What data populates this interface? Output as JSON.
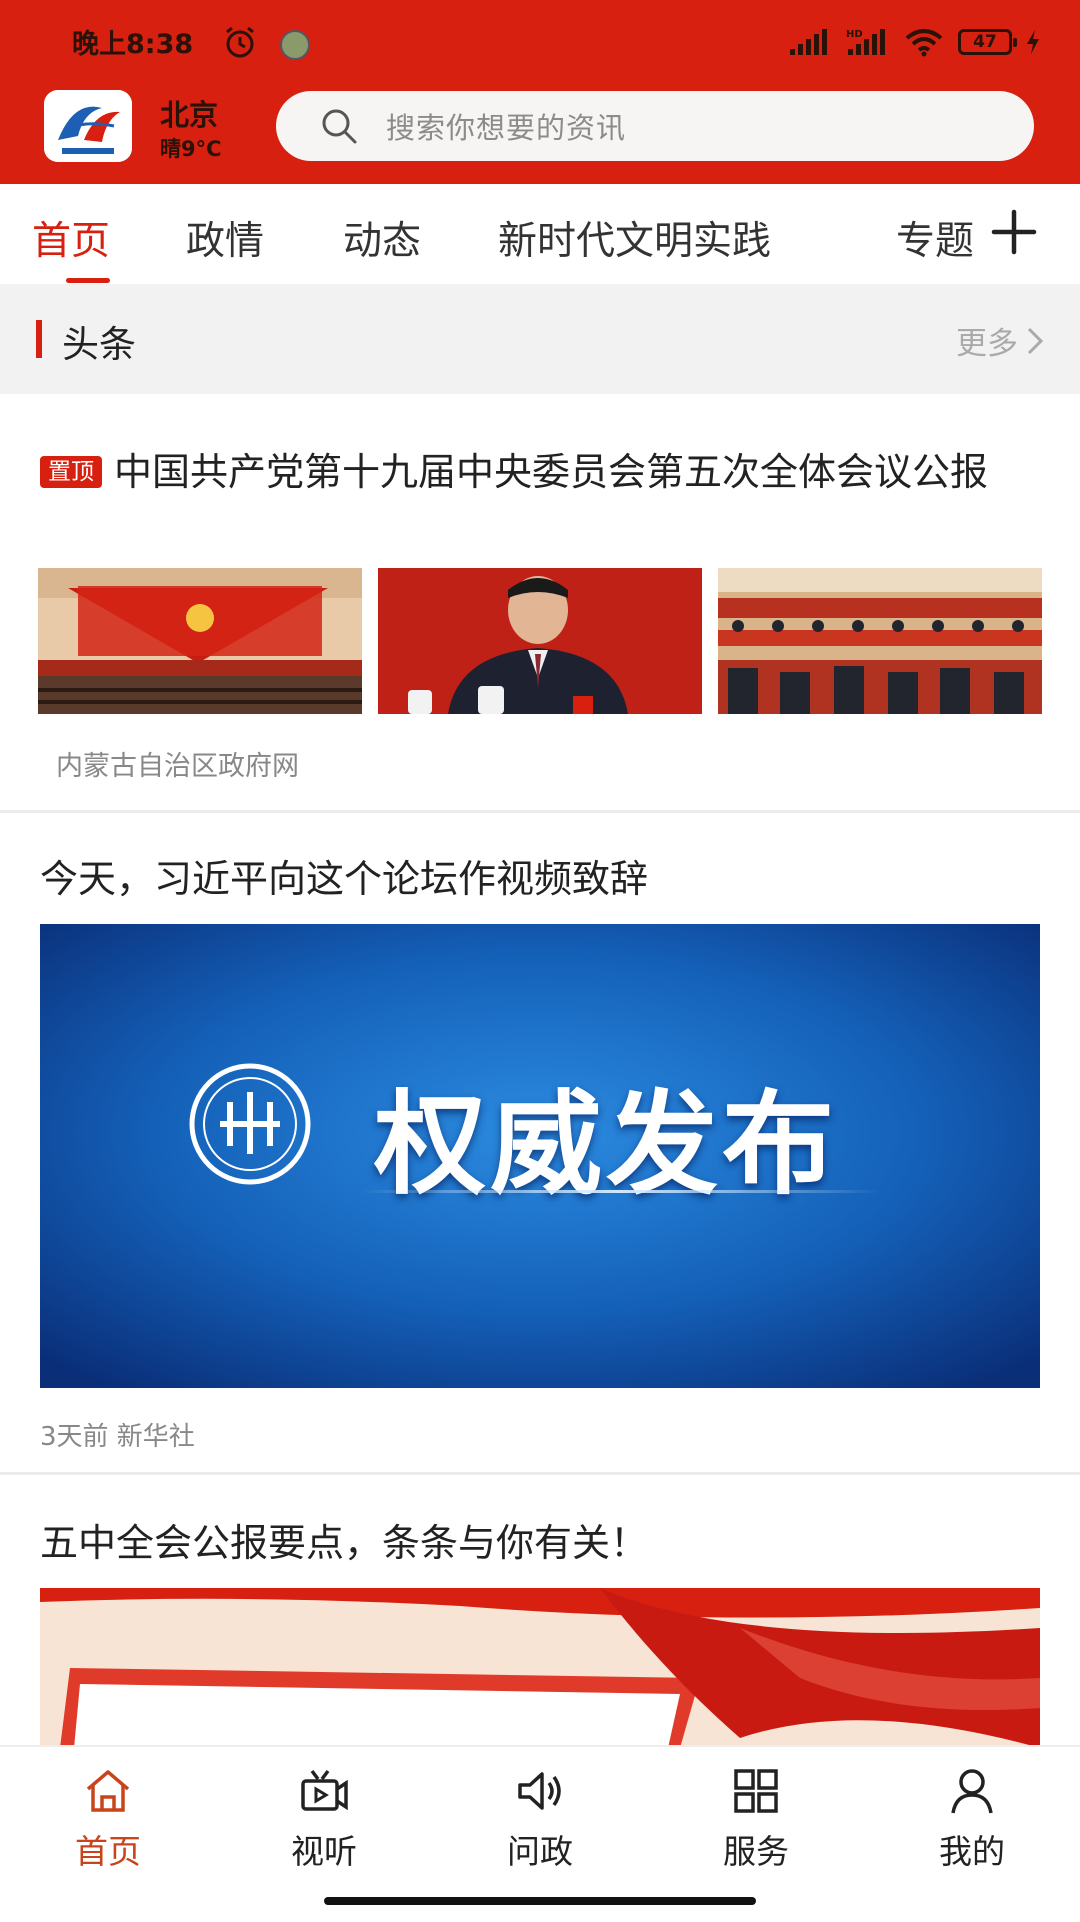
{
  "status_bar": {
    "time": "晚上8:38",
    "battery": "47"
  },
  "header": {
    "city": "北京",
    "weather": "晴9°C",
    "search_placeholder": "搜索你想要的资讯"
  },
  "tabs": [
    {
      "label": "首页",
      "active": true
    },
    {
      "label": "政情",
      "active": false
    },
    {
      "label": "动态",
      "active": false
    },
    {
      "label": "新时代文明实践",
      "active": false
    },
    {
      "label": "专题",
      "active": false
    }
  ],
  "section": {
    "title": "头条",
    "more": "更多"
  },
  "articles": [
    {
      "badge": "置顶",
      "title": "中国共产党第十九届中央委员会第五次全体会议公报",
      "source": "内蒙古自治区政府网"
    },
    {
      "title": "今天，习近平向这个论坛作视频致辞",
      "banner_text": "权威发布",
      "meta": "3天前  新华社"
    },
    {
      "title": "五中全会公报要点，条条与你有关！"
    }
  ],
  "bottom_nav": [
    {
      "label": "首页",
      "icon": "home-icon",
      "active": true
    },
    {
      "label": "视听",
      "icon": "video-icon",
      "active": false
    },
    {
      "label": "问政",
      "icon": "speaker-icon",
      "active": false
    },
    {
      "label": "服务",
      "icon": "grid-icon",
      "active": false
    },
    {
      "label": "我的",
      "icon": "user-icon",
      "active": false
    }
  ],
  "colors": {
    "brand_red": "#d7200f",
    "active_nav": "#c8451c"
  }
}
